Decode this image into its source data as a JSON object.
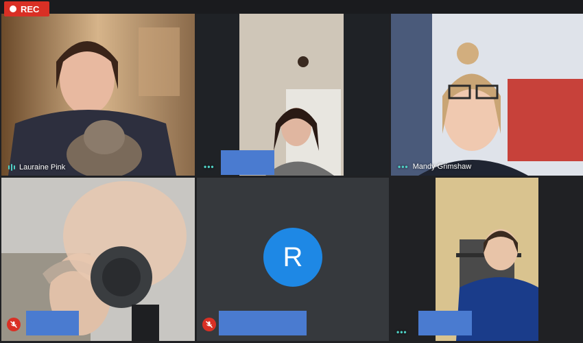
{
  "recording": {
    "label": "REC"
  },
  "participants": [
    {
      "name": "Lauraine Pink",
      "status": "speaking"
    },
    {
      "name": "",
      "status": "redacted"
    },
    {
      "name": "Mandy Grimshaw",
      "status": "connected"
    },
    {
      "name": "",
      "status": "muted, redacted"
    },
    {
      "name": "",
      "status": "muted, redacted",
      "avatar_letter": "R"
    },
    {
      "name": "",
      "status": "redacted"
    }
  ],
  "colors": {
    "rec": "#d93025",
    "avatar": "#1e88e5",
    "redaction": "#4a7bd0",
    "indicator": "#4fd1c5"
  },
  "icons": [
    "record-dot-icon",
    "audio-level-icon",
    "more-dots-icon",
    "mic-off-icon"
  ]
}
